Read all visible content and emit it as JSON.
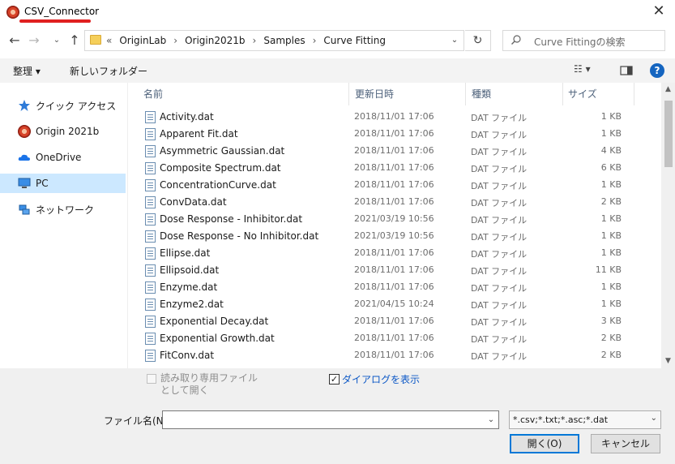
{
  "window": {
    "title": "CSV_Connector",
    "close_glyph": "✕",
    "accent_underline_color": "#e02020"
  },
  "nav": {
    "back_glyph": "←",
    "forward_glyph": "→",
    "recent_glyph": "⌄",
    "up_glyph": "↑",
    "refresh_glyph": "↻",
    "dropdown_glyph": "⌄",
    "breadcrumb_prefix": "«",
    "breadcrumbs": [
      "OriginLab",
      "Origin2021b",
      "Samples",
      "Curve Fitting"
    ],
    "separator": "›"
  },
  "search": {
    "placeholder": "Curve Fittingの検索",
    "icon": "search-icon"
  },
  "toolbar": {
    "organize_label": "整理 ▾",
    "new_folder_label": "新しいフォルダー",
    "view_glyph": "☷ ▾",
    "help_glyph": "?",
    "background": "#f3f3f3"
  },
  "sidebar": {
    "items": [
      {
        "label": "クイック アクセス",
        "icon": "star-icon"
      },
      {
        "label": "Origin 2021b",
        "icon": "origin-app-icon"
      },
      {
        "label": "OneDrive",
        "icon": "cloud-icon"
      },
      {
        "label": "PC",
        "icon": "computer-icon",
        "selected": true
      },
      {
        "label": "ネットワーク",
        "icon": "network-icon"
      }
    ],
    "selected_color": "#cce8ff"
  },
  "filelist": {
    "columns": {
      "name": "名前",
      "date": "更新日時",
      "type": "種類",
      "size": "サイズ"
    },
    "sort_glyph": "^",
    "rows": [
      {
        "name": "Activity.dat",
        "date": "2018/11/01 17:06",
        "type": "DAT ファイル",
        "size": "1 KB"
      },
      {
        "name": "Apparent Fit.dat",
        "date": "2018/11/01 17:06",
        "type": "DAT ファイル",
        "size": "1 KB"
      },
      {
        "name": "Asymmetric Gaussian.dat",
        "date": "2018/11/01 17:06",
        "type": "DAT ファイル",
        "size": "4 KB"
      },
      {
        "name": "Composite Spectrum.dat",
        "date": "2018/11/01 17:06",
        "type": "DAT ファイル",
        "size": "6 KB"
      },
      {
        "name": "ConcentrationCurve.dat",
        "date": "2018/11/01 17:06",
        "type": "DAT ファイル",
        "size": "1 KB"
      },
      {
        "name": "ConvData.dat",
        "date": "2018/11/01 17:06",
        "type": "DAT ファイル",
        "size": "2 KB"
      },
      {
        "name": "Dose Response - Inhibitor.dat",
        "date": "2021/03/19 10:56",
        "type": "DAT ファイル",
        "size": "1 KB"
      },
      {
        "name": "Dose Response - No Inhibitor.dat",
        "date": "2021/03/19 10:56",
        "type": "DAT ファイル",
        "size": "1 KB"
      },
      {
        "name": "Ellipse.dat",
        "date": "2018/11/01 17:06",
        "type": "DAT ファイル",
        "size": "1 KB"
      },
      {
        "name": "Ellipsoid.dat",
        "date": "2018/11/01 17:06",
        "type": "DAT ファイル",
        "size": "11 KB"
      },
      {
        "name": "Enzyme.dat",
        "date": "2018/11/01 17:06",
        "type": "DAT ファイル",
        "size": "1 KB"
      },
      {
        "name": "Enzyme2.dat",
        "date": "2021/04/15 10:24",
        "type": "DAT ファイル",
        "size": "1 KB"
      },
      {
        "name": "Exponential Decay.dat",
        "date": "2018/11/01 17:06",
        "type": "DAT ファイル",
        "size": "3 KB"
      },
      {
        "name": "Exponential Growth.dat",
        "date": "2018/11/01 17:06",
        "type": "DAT ファイル",
        "size": "2 KB"
      },
      {
        "name": "FitConv.dat",
        "date": "2018/11/01 17:06",
        "type": "DAT ファイル",
        "size": "2 KB"
      }
    ]
  },
  "scrollbar": {
    "up_glyph": "▲",
    "down_glyph": "▼"
  },
  "bottom": {
    "readonly_label": "読み取り専用ファイルとして開く",
    "readonly_checked": false,
    "show_dialog_label": "ダイアログを表示",
    "show_dialog_checked": true,
    "check_glyph": "✓",
    "filename_label": "ファイル名(N):",
    "filename_value": "",
    "filetype_value": "*.csv;*.txt;*.asc;*.dat",
    "open_label": "開く(O)",
    "cancel_label": "キャンセル",
    "link_color": "#0b57c6",
    "focus_color": "#0078d7"
  }
}
